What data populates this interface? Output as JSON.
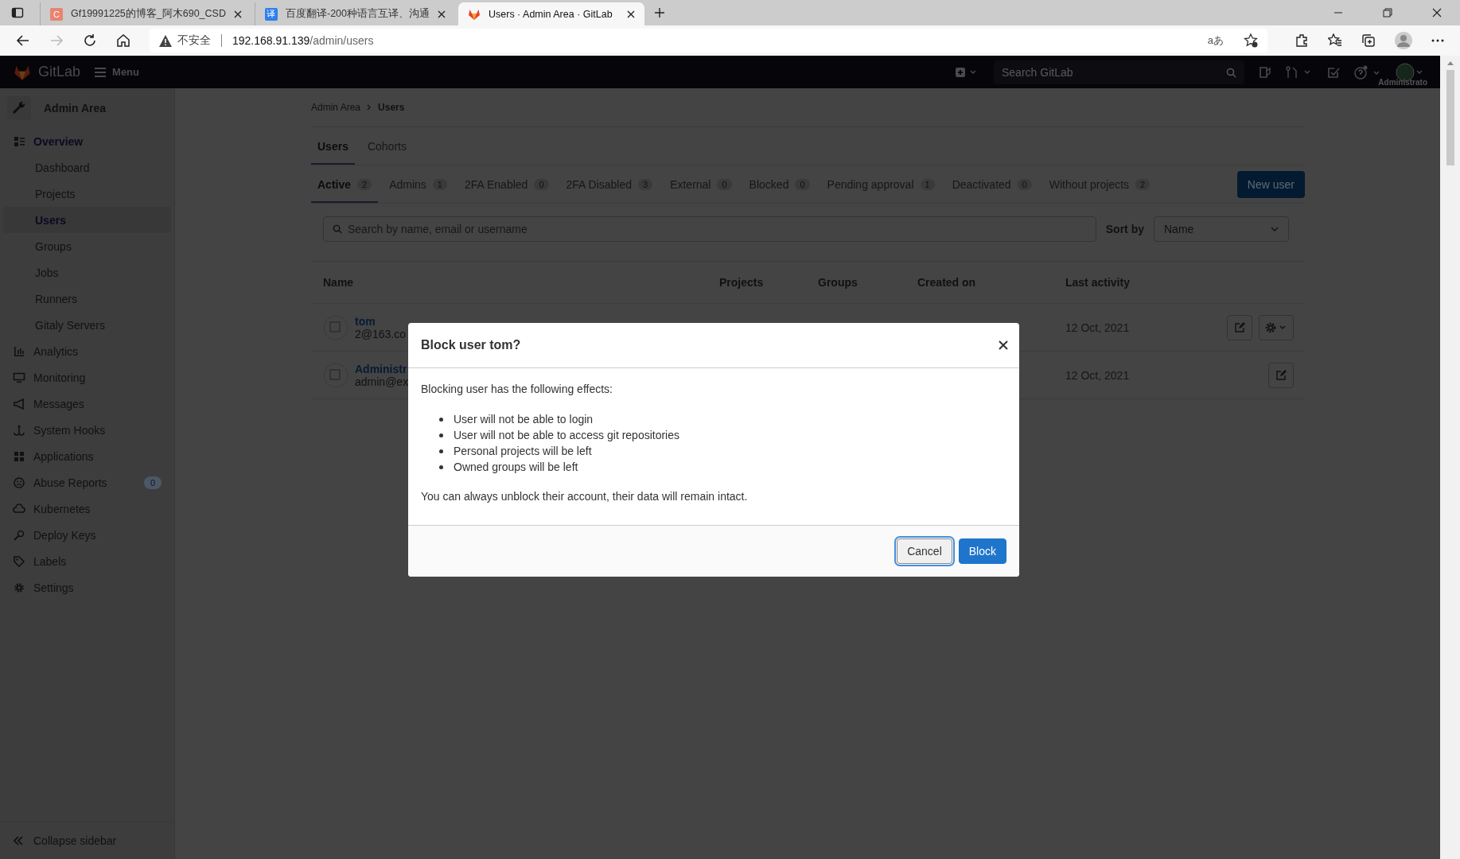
{
  "browser": {
    "tabs": [
      {
        "title": "Gf19991225的博客_阿木690_CSD",
        "selected": false,
        "favicon": "C",
        "color": "#e8846f"
      },
      {
        "title": "百度翻译-200种语言互译、沟通",
        "selected": false,
        "favicon": "译",
        "color": "#2e7ff0"
      },
      {
        "title": "Users · Admin Area · GitLab",
        "selected": true
      }
    ],
    "address": {
      "warning": "不安全",
      "host": "192.168.91.139",
      "path": "/admin/users"
    },
    "translate": "aあ"
  },
  "header": {
    "logo": "GitLab",
    "menu": "Menu",
    "search_placeholder": "Search GitLab",
    "user": "Administrato"
  },
  "sidebar": {
    "title": "Admin Area",
    "items": [
      {
        "label": "Overview",
        "expanded": true,
        "children": [
          {
            "label": "Dashboard",
            "selected": false
          },
          {
            "label": "Projects",
            "selected": false
          },
          {
            "label": "Users",
            "selected": true
          },
          {
            "label": "Groups",
            "selected": false
          },
          {
            "label": "Jobs",
            "selected": false
          },
          {
            "label": "Runners",
            "selected": false
          },
          {
            "label": "Gitaly Servers",
            "selected": false
          }
        ]
      },
      {
        "label": "Analytics"
      },
      {
        "label": "Monitoring"
      },
      {
        "label": "Messages"
      },
      {
        "label": "System Hooks"
      },
      {
        "label": "Applications"
      },
      {
        "label": "Abuse Reports",
        "badge": "0"
      },
      {
        "label": "Kubernetes"
      },
      {
        "label": "Deploy Keys"
      },
      {
        "label": "Labels"
      },
      {
        "label": "Settings"
      }
    ],
    "collapse": "Collapse sidebar"
  },
  "breadcrumb": [
    "Admin Area",
    "Users"
  ],
  "tabs": [
    {
      "label": "Users",
      "selected": true
    },
    {
      "label": "Cohorts",
      "selected": false
    }
  ],
  "filters": [
    {
      "label": "Active",
      "count": "2",
      "selected": true
    },
    {
      "label": "Admins",
      "count": "1",
      "selected": false
    },
    {
      "label": "2FA Enabled",
      "count": "0",
      "selected": false
    },
    {
      "label": "2FA Disabled",
      "count": "3",
      "selected": false
    },
    {
      "label": "External",
      "count": "0",
      "selected": false
    },
    {
      "label": "Blocked",
      "count": "0",
      "selected": false
    },
    {
      "label": "Pending approval",
      "count": "1",
      "selected": false
    },
    {
      "label": "Deactivated",
      "count": "0",
      "selected": false
    },
    {
      "label": "Without projects",
      "count": "2",
      "selected": false
    }
  ],
  "new_user": "New user",
  "search": {
    "placeholder": "Search by name, email or username"
  },
  "sort": {
    "label": "Sort by",
    "value": "Name"
  },
  "table": {
    "columns": [
      "Name",
      "Projects",
      "Groups",
      "Created on",
      "Last activity"
    ],
    "rows": [
      {
        "name": "tom",
        "email": "2@163.co",
        "last_activity": "12 Oct, 2021",
        "settings_menu": true
      },
      {
        "name": "Administr",
        "email": "admin@ex",
        "last_activity": "12 Oct, 2021",
        "settings_menu": false
      }
    ]
  },
  "modal": {
    "title": "Block user tom?",
    "intro": "Blocking user has the following effects:",
    "effects": [
      "User will not be able to login",
      "User will not be able to access git repositories",
      "Personal projects will be left",
      "Owned groups will be left"
    ],
    "note": "You can always unblock their account, their data will remain intact.",
    "buttons": [
      {
        "label": "Cancel",
        "kind": "secondary",
        "focused": true
      },
      {
        "label": "Block",
        "kind": "primary",
        "focused": false
      }
    ]
  }
}
